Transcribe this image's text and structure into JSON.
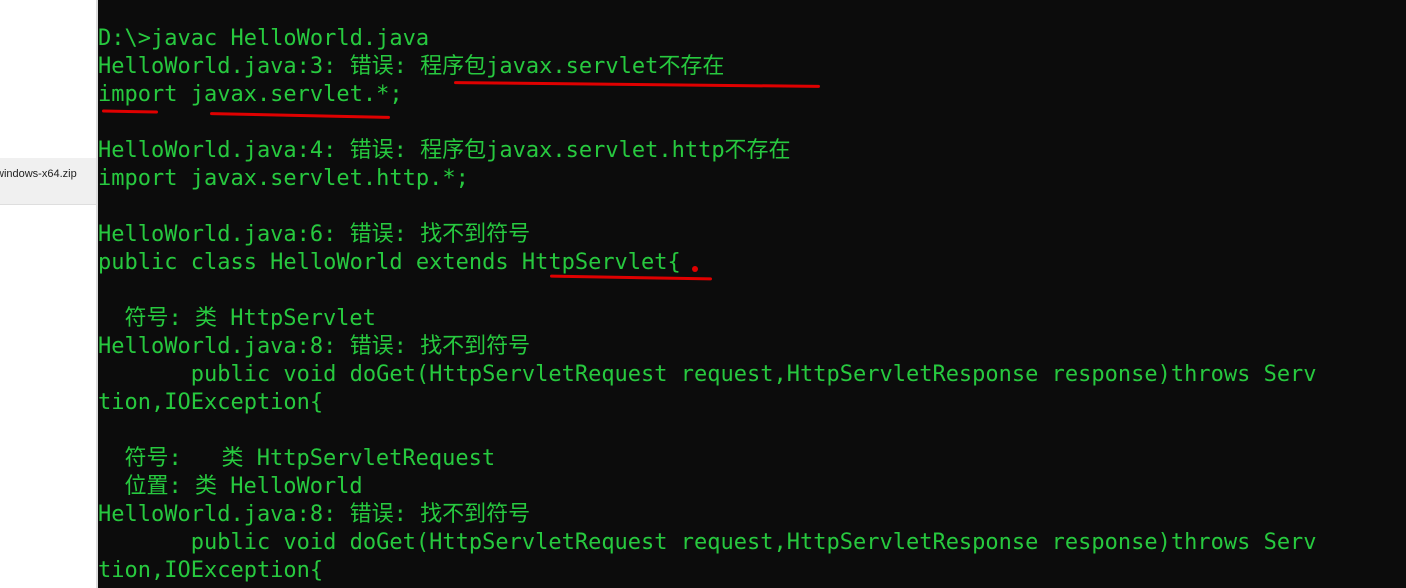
{
  "explorer": {
    "file_name": "windows-x64.zip"
  },
  "console": {
    "lines": [
      "D:\\>javac HelloWorld.java",
      "HelloWorld.java:3: 错误: 程序包javax.servlet不存在",
      "import javax.servlet.*;",
      "HelloWorld.java:4: 错误: 程序包javax.servlet.http不存在",
      "import javax.servlet.http.*;",
      "HelloWorld.java:6: 错误: 找不到符号",
      "public class HelloWorld extends HttpServlet{",
      "  符号: 类 HttpServlet",
      "HelloWorld.java:8: 错误: 找不到符号",
      "       public void doGet(HttpServletRequest request,HttpServletResponse response)throws Serv",
      "tion,IOException{",
      "  符号:   类 HttpServletRequest",
      "  位置: 类 HelloWorld",
      "HelloWorld.java:8: 错误: 找不到符号",
      "       public void doGet(HttpServletRequest request,HttpServletResponse response)throws Serv",
      "tion,IOException{"
    ]
  },
  "colors": {
    "console_background": "#0c0c0c",
    "console_text": "#27c93f",
    "annotation": "#e00000"
  }
}
